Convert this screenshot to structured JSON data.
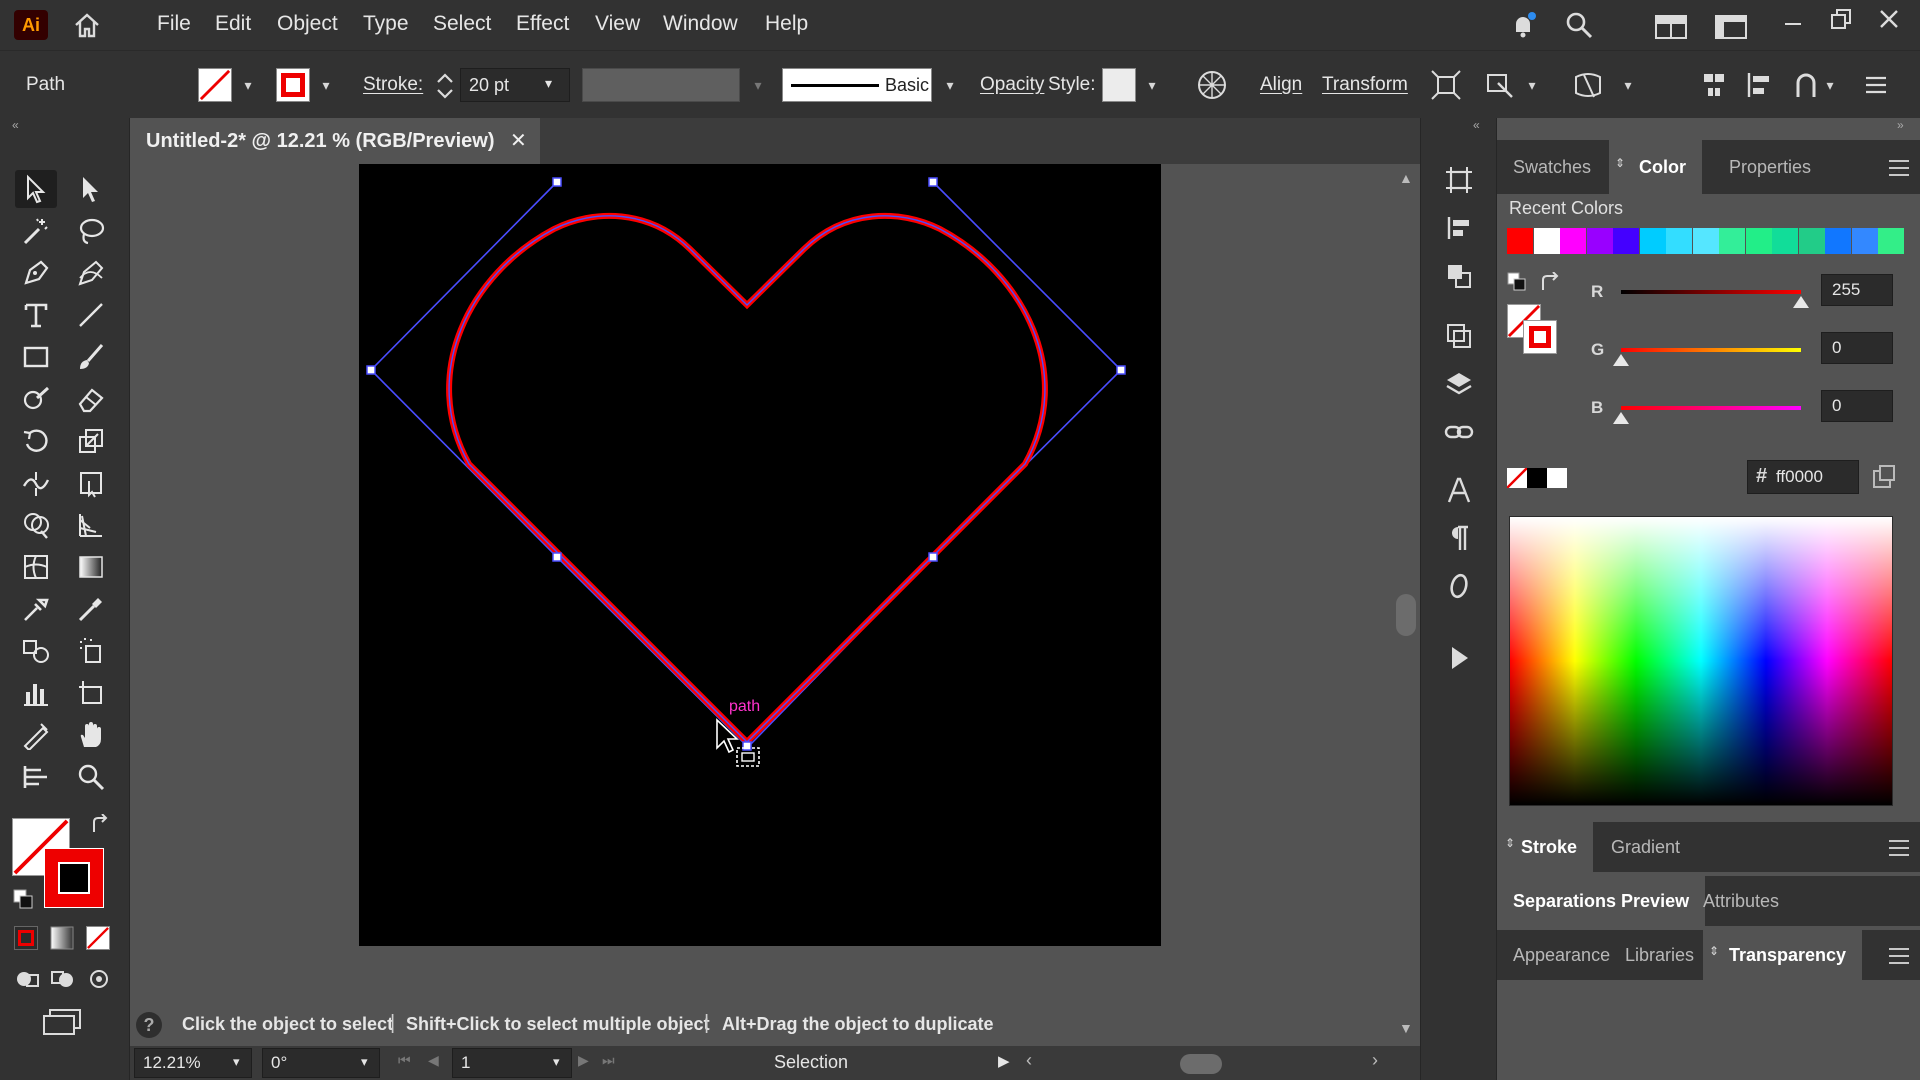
{
  "app": {
    "logo": "Ai"
  },
  "menu": [
    "File",
    "Edit",
    "Object",
    "Type",
    "Select",
    "Effect",
    "View",
    "Window",
    "Help"
  ],
  "control": {
    "selection_type": "Path",
    "stroke_label": "Stroke:",
    "stroke_weight": "20 pt",
    "profile_label": "Basic",
    "opacity_label": "Opacity",
    "style_label": "Style:",
    "align_label": "Align",
    "transform_label": "Transform"
  },
  "document": {
    "tab_title": "Untitled-2* @ 12.21 % (RGB/Preview)",
    "close": "✕"
  },
  "canvas": {
    "artboard_color": "#000000",
    "path_stroke_color": "#ff0000",
    "bounding_color": "#3f47ff",
    "hover_label": "path"
  },
  "status": {
    "help_icon": "?",
    "hint_1": "Click the object to select",
    "hint_2": "Shift+Click to select multiple object",
    "hint_3": "Alt+Drag the object to duplicate",
    "zoom": "12.21%",
    "rotation": "0°",
    "artboard_number": "1",
    "tool_name": "Selection"
  },
  "panels": {
    "tabs_top": [
      "Swatches",
      "Color",
      "Properties"
    ],
    "active_top": "Color",
    "recent_colors_label": "Recent Colors",
    "recent_colors": [
      "#ff0000",
      "#ffffff",
      "#ff00ff",
      "#9900ff",
      "#4400ff",
      "#00ccff",
      "#33ddff",
      "#55e6ff",
      "#33ee99",
      "#22ee88",
      "#11dd99",
      "#22cc88",
      "#1177ff",
      "#3388ff",
      "#33ee88"
    ],
    "channels": [
      {
        "name": "R",
        "value": "255",
        "fraction": 1.0
      },
      {
        "name": "G",
        "value": "0",
        "fraction": 0.0
      },
      {
        "name": "B",
        "value": "0",
        "fraction": 0.0
      }
    ],
    "hex_prefix": "#",
    "hex_value": "ff0000",
    "tabs_stroke": [
      "Stroke",
      "Gradient"
    ],
    "tabs_sep": [
      "Separations Preview",
      "Attributes"
    ],
    "tabs_bottom": [
      "Appearance",
      "Libraries",
      "Transparency"
    ]
  }
}
